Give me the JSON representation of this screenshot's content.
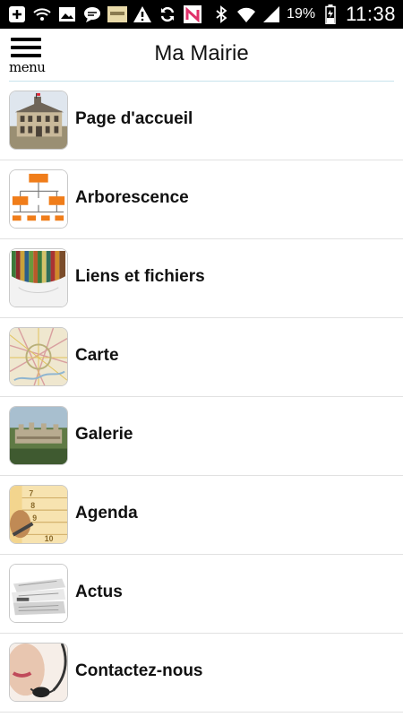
{
  "statusbar": {
    "battery_percent": "19%",
    "time": "11:38"
  },
  "header": {
    "menu_label": "menu",
    "title": "Ma Mairie"
  },
  "items": [
    {
      "label": "Page d'accueil",
      "icon": "town-hall-icon"
    },
    {
      "label": "Arborescence",
      "icon": "org-chart-icon"
    },
    {
      "label": "Liens et fichiers",
      "icon": "files-icon"
    },
    {
      "label": "Carte",
      "icon": "map-icon"
    },
    {
      "label": "Galerie",
      "icon": "gallery-icon"
    },
    {
      "label": "Agenda",
      "icon": "calendar-icon"
    },
    {
      "label": "Actus",
      "icon": "newspaper-icon"
    },
    {
      "label": "Contactez-nous",
      "icon": "headset-icon"
    }
  ],
  "colors": {
    "statusbar_bg": "#000000",
    "accent_orange": "#f07d1a",
    "divider": "#e1e1e1"
  }
}
